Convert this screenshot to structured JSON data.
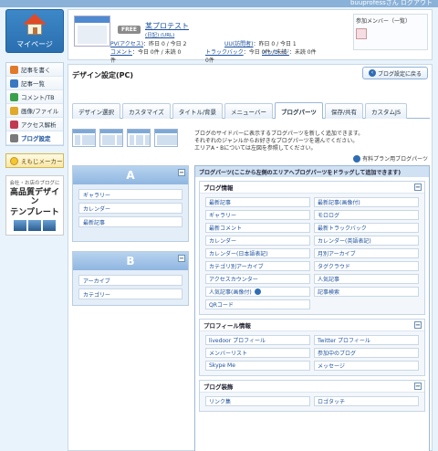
{
  "top": {
    "user": "buuprofessさん  ログアウト"
  },
  "sidebar": {
    "mypage_label": "マイページ",
    "items": [
      {
        "label": "記事を書く",
        "icon": "pencil-icon",
        "color": "#e07a2a"
      },
      {
        "label": "記事一覧",
        "icon": "list-icon",
        "color": "#3a78c2"
      },
      {
        "label": "コメント/TB",
        "icon": "comment-icon",
        "color": "#3ba04a"
      },
      {
        "label": "画像/ファイル",
        "icon": "image-icon",
        "color": "#e0a92a"
      },
      {
        "label": "アクセス解析",
        "icon": "chart-icon",
        "color": "#c23a4f"
      },
      {
        "label": "ブログ設定",
        "icon": "wrench-icon",
        "color": "#7a7a7a"
      }
    ],
    "emoji_label": "えもじメーカー",
    "ad": {
      "line1": "会社・お店のブログに",
      "line2": "高品質デザイン",
      "line3": "テンプレート"
    }
  },
  "header": {
    "badge": "FREE",
    "blog_title": "某プロテスト",
    "links": "(日記) (URL)",
    "stats": [
      [
        {
          "label": "PV(アクセス)",
          "value": "：昨日 0 / 今日 2"
        },
        {
          "label": "UU(訪問者)",
          "value": "：昨日 0 / 今日 1"
        }
      ],
      [
        {
          "label": "コメント",
          "value": "：今日 0件 / 未読 0件"
        },
        {
          "label": "トラックバック",
          "value": "：今日 0件 / 未読 0件"
        },
        {
          "label": "メッセージ",
          "value": "：未読 0件"
        }
      ]
    ],
    "members_title": "参加メンバー（一覧）"
  },
  "main": {
    "title": "デザイン設定(PC)",
    "back_button": "ブログ設定に戻る",
    "tabs": [
      "デザイン選択",
      "カスタマイズ",
      "タイトル/背景",
      "メニューバー",
      "ブログパーツ",
      "保存/共有",
      "カスタムJS"
    ],
    "active_tab": 4,
    "description": [
      "ブログのサイドバーに表示するブログパーツを新しく追加できます。",
      "それぞれのジャンルからお好きなブログパーツを選んでください。",
      "エリアA・Bについては左図を参照してください。"
    ],
    "legend": "有料プラン用ブログパーツ",
    "area_a": {
      "label": "A",
      "parts": [
        "ギャラリー",
        "カレンダー",
        "最新記事"
      ]
    },
    "area_b": {
      "label": "B",
      "parts": [
        "アーカイブ",
        "カテゴリー"
      ]
    },
    "parts_header": "ブログパーツ(ここから左側のエリアへブログパーツをドラッグして追加できます)",
    "categories": [
      {
        "title": "ブログ情報",
        "items": [
          "最新記事",
          "最新記事(画像付)",
          "ギャラリー",
          "モロログ",
          "最新コメント",
          "最新トラックバック",
          "カレンダー",
          "カレンダー(英語表記)",
          "カレンダー(日本語表記)",
          "月別アーカイブ",
          "カテゴリ別アーカイブ",
          "タグクラウド",
          "アクセスカウンター",
          "人気記事",
          "人気記事(画像付)",
          "記事検索",
          "QRコード"
        ],
        "paid": [
          14
        ]
      },
      {
        "title": "プロフィール情報",
        "items": [
          "livedoor プロフィール",
          "Twitter プロフィール",
          "メンバーリスト",
          "参加中のブログ",
          "Skype Me",
          "メッセージ"
        ],
        "paid": []
      },
      {
        "title": "ブログ装飾",
        "items": [
          "リンク集",
          "ロゴタッチ"
        ],
        "paid": []
      }
    ]
  }
}
